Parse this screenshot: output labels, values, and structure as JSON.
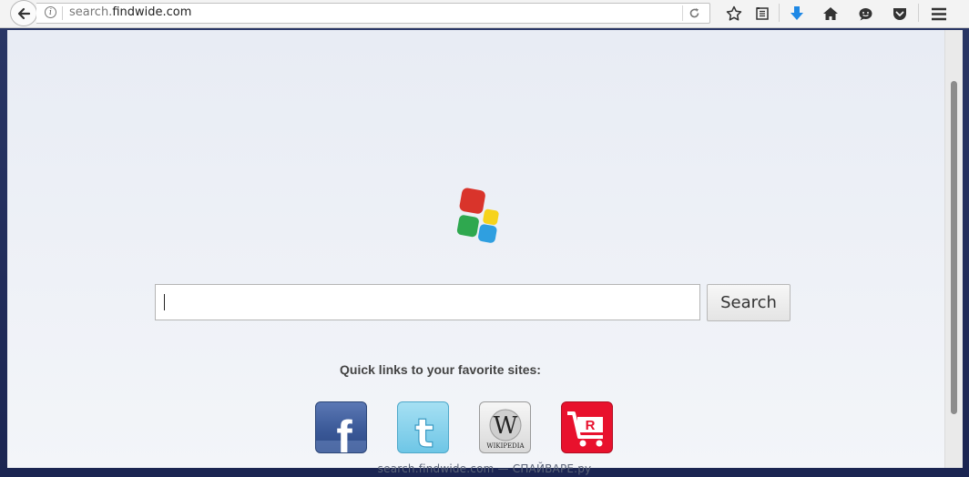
{
  "browser": {
    "url_prefix": "search.",
    "url_host": "findwide.com",
    "icons": [
      "back-arrow-icon",
      "info-icon",
      "reload-icon",
      "bookmark-star-icon",
      "reading-list-icon",
      "download-icon",
      "home-icon",
      "chat-icon",
      "pocket-icon",
      "menu-icon"
    ]
  },
  "search": {
    "input_value": "",
    "button_label": "Search"
  },
  "quick_links": {
    "title": "Quick links to your favorite sites:",
    "items": [
      {
        "name": "Facebook",
        "glyph": "f",
        "color": "#3b5998"
      },
      {
        "name": "Twitter",
        "glyph": "t",
        "color": "#6ec6e6"
      },
      {
        "name": "Wikipedia",
        "glyph": "W",
        "caption": "WIKIPEDIA",
        "color": "#e6e6e6"
      },
      {
        "name": "Rakuten",
        "glyph": "R",
        "color": "#e8112d"
      }
    ]
  },
  "status_text": "search.findwide.com — СПАЙВАРЕ.ру",
  "colors": {
    "logo_red": "#d9342b",
    "logo_yellow": "#f6d31c",
    "logo_green": "#2fa84f",
    "logo_blue": "#2f9fe0",
    "download_blue": "#1e88e5"
  }
}
